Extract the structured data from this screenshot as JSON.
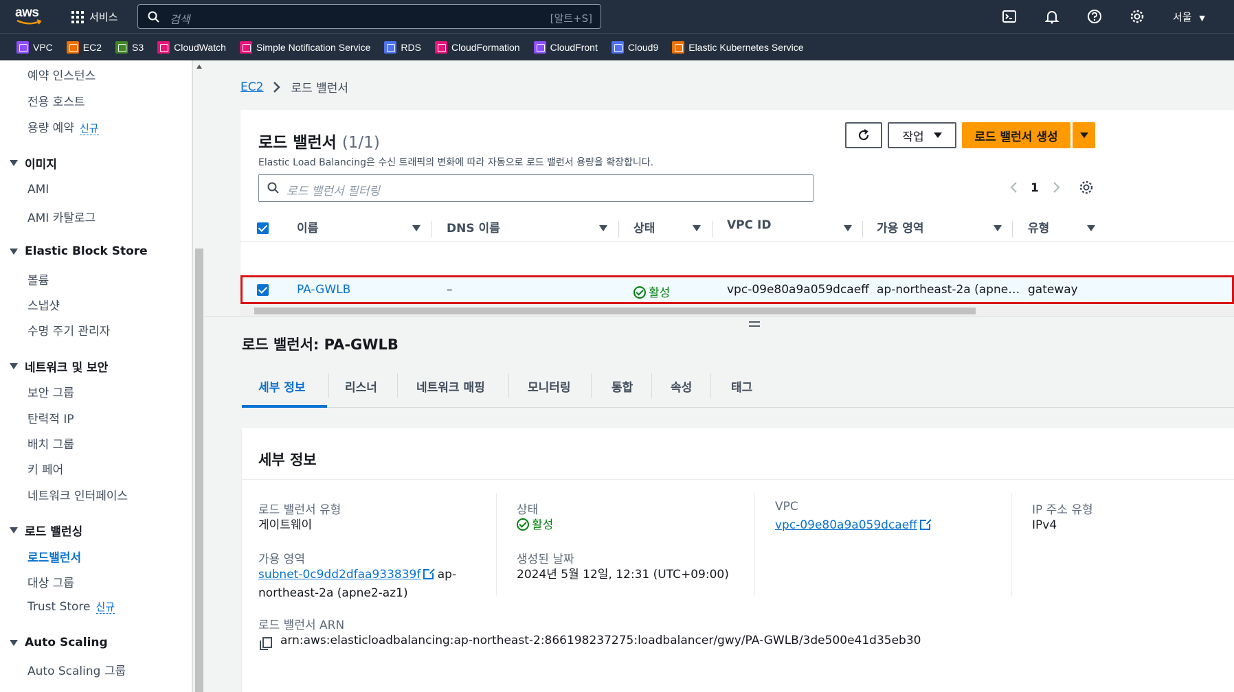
{
  "topnav": {
    "logo": "aws",
    "services_label": "서비스",
    "search_placeholder": "검색",
    "search_shortcut": "[알트+S]",
    "region": "서울"
  },
  "favorites": [
    {
      "label": "VPC",
      "color": "#8c4fff"
    },
    {
      "label": "EC2",
      "color": "#ed7100"
    },
    {
      "label": "S3",
      "color": "#3f8624"
    },
    {
      "label": "CloudWatch",
      "color": "#e7157b"
    },
    {
      "label": "Simple Notification Service",
      "color": "#e7157b"
    },
    {
      "label": "RDS",
      "color": "#4d72f3"
    },
    {
      "label": "CloudFormation",
      "color": "#e7157b"
    },
    {
      "label": "CloudFront",
      "color": "#8c4fff"
    },
    {
      "label": "Cloud9",
      "color": "#4d72f3"
    },
    {
      "label": "Elastic Kubernetes Service",
      "color": "#ed7100"
    }
  ],
  "sidebar": {
    "new_badge": "신규",
    "items": {
      "reserved": "예약 인스턴스",
      "dedicated": "전용 호스트",
      "capacity": "용량 예약",
      "images_head": "이미지",
      "ami": "AMI",
      "ami_catalog": "AMI 카탈로그",
      "ebs_head": "Elastic Block Store",
      "volumes": "볼륨",
      "snapshots": "스냅샷",
      "lifecycle": "수명 주기 관리자",
      "net_head": "네트워크 및 보안",
      "sg": "보안 그룹",
      "eip": "탄력적 IP",
      "placement": "배치 그룹",
      "keypair": "키 페어",
      "eni": "네트워크 인터페이스",
      "lb_head": "로드 밸런싱",
      "lb": "로드밸런서",
      "tg": "대상 그룹",
      "trust": "Trust Store",
      "as_head": "Auto Scaling",
      "asg": "Auto Scaling 그룹"
    }
  },
  "breadcrumb": {
    "root": "EC2",
    "current": "로드 밸런서"
  },
  "lb_panel": {
    "title": "로드 밸런서",
    "count": "(1/1)",
    "description": "Elastic Load Balancing은 수신 트래픽의 변화에 따라 자동으로 로드 밸런서 용량을 확장합니다.",
    "actions_label": "작업",
    "create_label": "로드 밸런서 생성",
    "filter_placeholder": "로드 밸런서 필터링",
    "page": "1",
    "columns": [
      "이름",
      "DNS 이름",
      "상태",
      "VPC ID",
      "가용 영역",
      "유형"
    ],
    "row": {
      "name": "PA-GWLB",
      "dns": "–",
      "state": "활성",
      "vpc": "vpc-09e80a9a059dcaeff",
      "az": "ap-northeast-2a (apne…",
      "type": "gateway"
    }
  },
  "detail": {
    "title": "로드 밸런서: PA-GWLB",
    "tabs": [
      "세부 정보",
      "리스너",
      "네트워크 매핑",
      "모니터링",
      "통합",
      "속성",
      "태그"
    ],
    "panel_title": "세부 정보",
    "type_label": "로드 밸런서 유형",
    "type_value": "게이트웨이",
    "state_label": "상태",
    "state_value": "활성",
    "vpc_label": "VPC",
    "vpc_value": "vpc-09e80a9a059dcaeff",
    "ipt_label": "IP 주소 유형",
    "ipt_value": "IPv4",
    "az_label": "가용 영역",
    "az_subnet": "subnet-0c9dd2dfaa933839f",
    "az_suffix1": "ap-",
    "az_suffix2": "northeast-2a (apne2-az1)",
    "created_label": "생성된 날짜",
    "created_value": "2024년 5월 12일, 12:31 (UTC+09:00)",
    "arn_label": "로드 밸런서 ARN",
    "arn_value": "arn:aws:elasticloadbalancing:ap-northeast-2:866198237275:loadbalancer/gwy/PA-GWLB/3de500e41d35eb30"
  }
}
